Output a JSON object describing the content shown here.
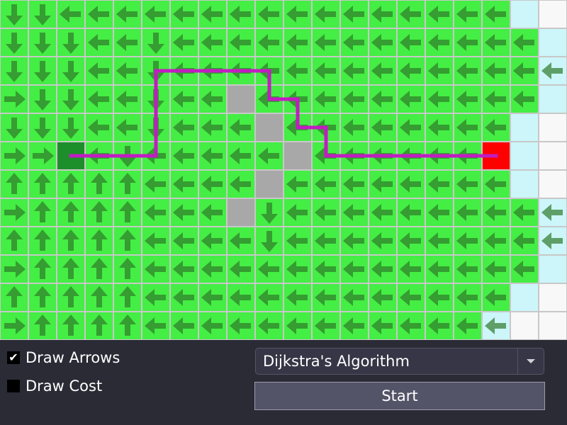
{
  "grid": {
    "cols": 20,
    "rows": 12,
    "colors": {
      "visited": "#44ee44",
      "frontier": "#ccf6fa",
      "unvisited": "#f8f8f8",
      "wall": "#a8a8a8",
      "start": "#1c8f2a",
      "goal": "#ff0000",
      "path": "#c21cc2",
      "arrow": "#2f7a2a",
      "gridline": "#c8c8c8"
    },
    "start": [
      2,
      5
    ],
    "goal": [
      17,
      5
    ],
    "walls": [
      [
        8,
        3
      ],
      [
        9,
        4
      ],
      [
        10,
        5
      ],
      [
        9,
        6
      ],
      [
        8,
        7
      ]
    ],
    "frontier": [
      [
        18,
        0
      ],
      [
        19,
        1
      ],
      [
        19,
        2
      ],
      [
        19,
        3
      ],
      [
        18,
        4
      ],
      [
        18,
        5
      ],
      [
        18,
        6
      ],
      [
        19,
        7
      ],
      [
        19,
        8
      ],
      [
        19,
        9
      ],
      [
        18,
        10
      ],
      [
        17,
        11
      ]
    ],
    "unvisited": [
      [
        19,
        0
      ],
      [
        19,
        4
      ],
      [
        19,
        5
      ],
      [
        19,
        6
      ],
      [
        19,
        10
      ],
      [
        18,
        11
      ],
      [
        19,
        11
      ]
    ],
    "path": [
      [
        17,
        5
      ],
      [
        11,
        5
      ],
      [
        11,
        4
      ],
      [
        10,
        4
      ],
      [
        10,
        3
      ],
      [
        9,
        3
      ],
      [
        9,
        2
      ],
      [
        5,
        2
      ],
      [
        5,
        5
      ],
      [
        2,
        5
      ]
    ],
    "arrows": [
      [
        "S",
        "S",
        "W",
        "W",
        "W",
        "W",
        "W",
        "W",
        "W",
        "W",
        "W",
        "W",
        "W",
        "W",
        "W",
        "W",
        "W",
        "W",
        "",
        ""
      ],
      [
        "S",
        "S",
        "S",
        "W",
        "W",
        "S",
        "W",
        "W",
        "W",
        "W",
        "W",
        "W",
        "W",
        "W",
        "W",
        "W",
        "W",
        "W",
        "W",
        ""
      ],
      [
        "S",
        "S",
        "S",
        "W",
        "W",
        "S",
        "W",
        "W",
        "W",
        "W",
        "W",
        "W",
        "W",
        "W",
        "W",
        "W",
        "W",
        "W",
        "W",
        "W"
      ],
      [
        "E",
        "S",
        "S",
        "W",
        "W",
        "S",
        "W",
        "W",
        "",
        "W",
        "W",
        "W",
        "W",
        "W",
        "W",
        "W",
        "W",
        "W",
        "W",
        ""
      ],
      [
        "S",
        "S",
        "S",
        "W",
        "W",
        "S",
        "W",
        "W",
        "W",
        "",
        "W",
        "W",
        "W",
        "W",
        "W",
        "W",
        "W",
        "W",
        "",
        ""
      ],
      [
        "E",
        "E",
        "",
        "W",
        "S",
        "W",
        "W",
        "W",
        "W",
        "W",
        "",
        "W",
        "W",
        "W",
        "W",
        "W",
        "W",
        "",
        "",
        ""
      ],
      [
        "N",
        "N",
        "N",
        "N",
        "N",
        "W",
        "W",
        "W",
        "W",
        "",
        "W",
        "W",
        "W",
        "W",
        "W",
        "W",
        "W",
        "W",
        "",
        ""
      ],
      [
        "E",
        "N",
        "N",
        "N",
        "N",
        "W",
        "W",
        "W",
        "",
        "S",
        "W",
        "W",
        "W",
        "W",
        "W",
        "W",
        "W",
        "W",
        "W",
        "W"
      ],
      [
        "N",
        "N",
        "N",
        "N",
        "N",
        "W",
        "W",
        "W",
        "W",
        "S",
        "W",
        "W",
        "W",
        "W",
        "W",
        "W",
        "W",
        "W",
        "W",
        "W"
      ],
      [
        "E",
        "N",
        "N",
        "N",
        "N",
        "W",
        "W",
        "W",
        "W",
        "W",
        "W",
        "W",
        "W",
        "W",
        "W",
        "W",
        "W",
        "W",
        "W",
        ""
      ],
      [
        "N",
        "N",
        "N",
        "N",
        "N",
        "W",
        "W",
        "W",
        "W",
        "W",
        "W",
        "W",
        "W",
        "W",
        "W",
        "W",
        "W",
        "W",
        "",
        ""
      ],
      [
        "E",
        "N",
        "N",
        "N",
        "N",
        "W",
        "W",
        "W",
        "W",
        "W",
        "W",
        "W",
        "W",
        "W",
        "W",
        "W",
        "W",
        "W",
        "",
        ""
      ]
    ]
  },
  "controls": {
    "draw_arrows": {
      "label": "Draw Arrows",
      "checked": true
    },
    "draw_cost": {
      "label": "Draw Cost",
      "checked": false
    },
    "algorithm": {
      "selected": "Dijkstra's Algorithm"
    },
    "start_label": "Start"
  }
}
